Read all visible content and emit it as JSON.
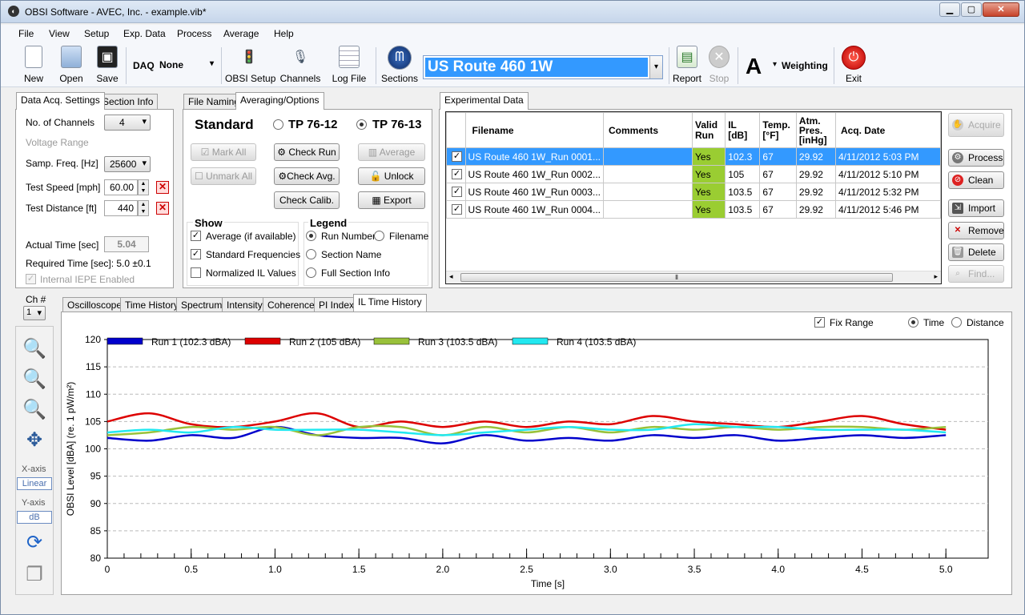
{
  "window": {
    "title": "OBSI Software - AVEC, Inc. - example.vib*"
  },
  "menu": [
    "File",
    "View",
    "Setup",
    "Exp. Data",
    "Process",
    "Average",
    "Help"
  ],
  "toolbar": {
    "new": "New",
    "open": "Open",
    "save": "Save",
    "daq_label": "DAQ",
    "daq_value": "None",
    "obsi_setup": "OBSI Setup",
    "channels": "Channels",
    "log_file": "Log File",
    "sections": "Sections",
    "section_name": "US Route 460 1W",
    "report": "Report",
    "stop": "Stop",
    "weighting_value": "A",
    "weighting_label": "Weighting",
    "exit": "Exit"
  },
  "acq_panel": {
    "tabs": [
      "Data Acq. Settings",
      "Section Info"
    ],
    "channels_label": "No. of Channels",
    "channels_value": "4",
    "voltage_range": "Voltage Range",
    "samp_label": "Samp. Freq. [Hz]",
    "samp_value": "25600",
    "speed_label": "Test Speed [mph]",
    "speed_value": "60.00",
    "distance_label": "Test Distance [ft]",
    "distance_value": "440",
    "actual_label": "Actual Time [sec]",
    "actual_value": "5.04",
    "required": "Required Time [sec]: 5.0 ±0.1",
    "iepe": "Internal IEPE Enabled"
  },
  "avg_panel": {
    "tabs": [
      "File Naming",
      "Averaging/Options"
    ],
    "standard": "Standard",
    "tp1": "TP 76-12",
    "tp2": "TP 76-13",
    "mark_all": "Mark All",
    "unmark_all": "Unmark All",
    "check_run": "Check Run",
    "check_avg": "Check Avg.",
    "check_calib": "Check Calib.",
    "average": "Average",
    "unlock": "Unlock",
    "export": "Export",
    "show_title": "Show",
    "show_items": [
      "Average (if available)",
      "Standard Frequencies",
      "Normalized IL Values"
    ],
    "legend_title": "Legend",
    "legend_items": [
      "Run Number",
      "Filename",
      "Section Name",
      "Full Section Info"
    ]
  },
  "exp_panel": {
    "tab": "Experimental Data",
    "headers": [
      "Filename",
      "Comments",
      "Valid Run",
      "IL [dB]",
      "Temp. [°F]",
      "Atm. Pres. [inHg]",
      "Acq. Date"
    ],
    "rows": [
      [
        "US Route 460 1W_Run 0001...",
        "",
        "Yes",
        "102.3",
        "67",
        "29.92",
        "4/11/2012 5:03 PM"
      ],
      [
        "US Route 460 1W_Run 0002...",
        "",
        "Yes",
        "105",
        "67",
        "29.92",
        "4/11/2012 5:10 PM"
      ],
      [
        "US Route 460 1W_Run 0003...",
        "",
        "Yes",
        "103.5",
        "67",
        "29.92",
        "4/11/2012 5:32 PM"
      ],
      [
        "US Route 460 1W_Run 0004...",
        "",
        "Yes",
        "103.5",
        "67",
        "29.92",
        "4/11/2012 5:46 PM"
      ]
    ],
    "buttons": {
      "acquire": "Acquire",
      "process": "Process",
      "clean": "Clean",
      "import": "Import",
      "remove": "Remove",
      "delete": "Delete",
      "find": "Find..."
    }
  },
  "left_tools": {
    "ch_label": "Ch #",
    "ch_value": "1",
    "xaxis_label": "X-axis",
    "xaxis_value": "Linear",
    "yaxis_label": "Y-axis",
    "yaxis_value": "dB"
  },
  "plot_tabs": [
    "Oscilloscope",
    "Time History",
    "Spectrum",
    "Intensity",
    "Coherence",
    "PI Index",
    "IL Time History"
  ],
  "plot_options": {
    "fix_range": "Fix Range",
    "time": "Time",
    "distance": "Distance"
  },
  "colors": {
    "run1": "#0000cc",
    "run2": "#dd0000",
    "run3": "#99c13a",
    "run4": "#22e8f0",
    "selected_row": "#3399ff",
    "valid": "#9acd32"
  },
  "chart_data": {
    "type": "line",
    "xlabel": "Time [s]",
    "ylabel": "OBSI Level [dBA] (re. 1 pW/m²)",
    "xlim": [
      0,
      5.0
    ],
    "ylim": [
      80,
      120
    ],
    "xticks": [
      "0",
      "0.5",
      "1.0",
      "1.5",
      "2.0",
      "2.5",
      "3.0",
      "3.5",
      "4.0",
      "4.5",
      "5.0"
    ],
    "yticks": [
      "80",
      "85",
      "90",
      "95",
      "100",
      "105",
      "110",
      "115",
      "120"
    ],
    "grid": "horizontal dashed",
    "legend_position": "top",
    "x": [
      0,
      0.25,
      0.5,
      0.75,
      1.0,
      1.25,
      1.5,
      1.75,
      2.0,
      2.25,
      2.5,
      2.75,
      3.0,
      3.25,
      3.5,
      3.75,
      4.0,
      4.25,
      4.5,
      4.75,
      5.0
    ],
    "series": [
      {
        "name": "Run 1 (102.3 dBA)",
        "color": "#0000cc",
        "values": [
          102,
          101.5,
          102.5,
          102,
          104,
          102.5,
          102,
          102,
          101,
          102.5,
          101.5,
          102,
          101.5,
          102.5,
          102,
          102.5,
          101.5,
          102,
          102.5,
          102,
          102.5
        ]
      },
      {
        "name": "Run 2 (105 dBA)",
        "color": "#dd0000",
        "values": [
          105,
          106.5,
          104.5,
          104,
          105,
          106.5,
          104,
          105,
          104,
          105,
          104,
          105,
          104.5,
          106,
          105,
          104.5,
          104,
          105,
          106,
          104.5,
          103.5
        ]
      },
      {
        "name": "Run 3 (103.5 dBA)",
        "color": "#99c13a",
        "values": [
          102.5,
          103,
          104,
          103.5,
          104,
          102.5,
          104,
          104,
          102.5,
          104,
          103,
          104,
          103,
          104,
          103.5,
          104,
          103.5,
          104,
          104,
          103.5,
          104
        ]
      },
      {
        "name": "Run 4 (103.5 dBA)",
        "color": "#22e8f0",
        "values": [
          103,
          103.5,
          103,
          104,
          103.5,
          103.5,
          103.5,
          103,
          102.5,
          103,
          103.5,
          104,
          103.5,
          103.5,
          104.5,
          104,
          104,
          103.5,
          103.5,
          103.5,
          103
        ]
      }
    ]
  }
}
